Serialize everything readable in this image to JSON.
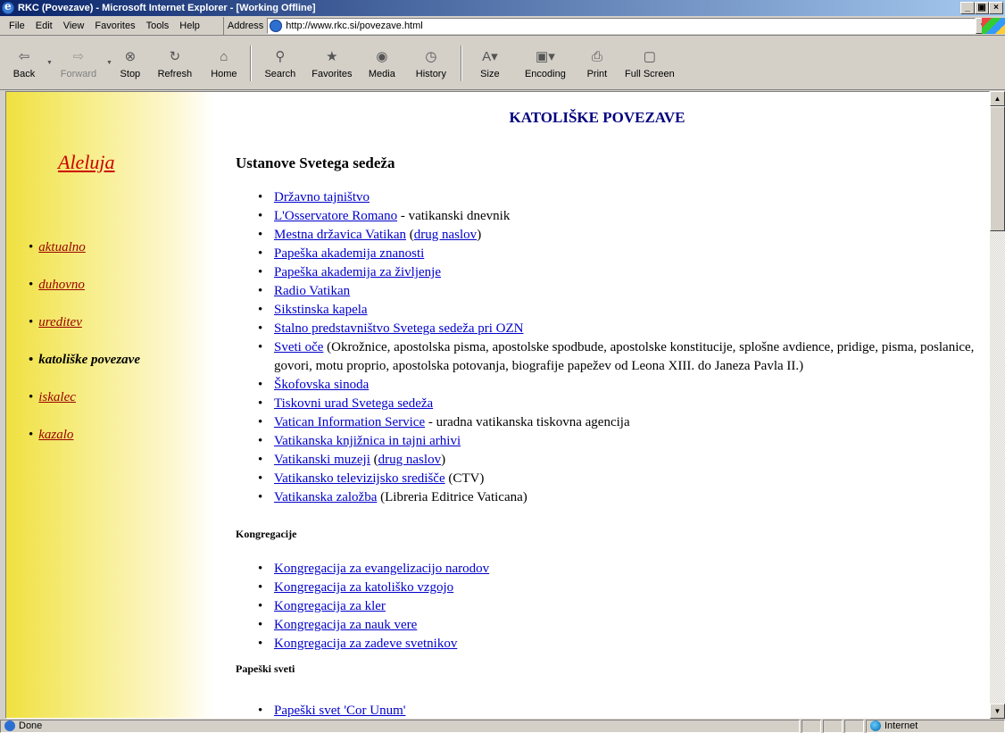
{
  "window": {
    "title": "RKC (Povezave) - Microsoft Internet Explorer - [Working Offline]",
    "buttons": [
      "_",
      "ѧ",
      "×"
    ]
  },
  "menu": [
    "File",
    "Edit",
    "View",
    "Favorites",
    "Tools",
    "Help"
  ],
  "address": {
    "label": "Address",
    "url": "http://www.rkc.si/povezave.html"
  },
  "toolbar": {
    "back": "Back",
    "forward": "Forward",
    "stop": "Stop",
    "refresh": "Refresh",
    "home": "Home",
    "search": "Search",
    "favorites": "Favorites",
    "media": "Media",
    "history": "History",
    "size": "Size",
    "encoding": "Encoding",
    "print": "Print",
    "fullscreen": "Full Screen"
  },
  "sidebar": {
    "logo": "Aleluja",
    "items": [
      {
        "label": "aktualno",
        "active": false
      },
      {
        "label": "duhovno",
        "active": false
      },
      {
        "label": "ureditev",
        "active": false
      },
      {
        "label": "katoliške povezave",
        "active": true
      },
      {
        "label": "iskalec",
        "active": false
      },
      {
        "label": "kazalo",
        "active": false
      }
    ]
  },
  "page": {
    "heading": "KATOLIŠKE POVEZAVE",
    "section1": {
      "title": "Ustanove Svetega sedeža",
      "items": [
        {
          "link": "Državno tajništvo"
        },
        {
          "link": "L'Osservatore Romano",
          "suffix": " - vatikanski dnevnik"
        },
        {
          "link": "Mestna državica Vatikan",
          "suffix": " (",
          "link2": "drug naslov",
          "suffix2": ")"
        },
        {
          "link": "Papeška akademija znanosti"
        },
        {
          "link": "Papeška akademija za življenje"
        },
        {
          "link": "Radio Vatikan"
        },
        {
          "link": "Sikstinska kapela"
        },
        {
          "link": "Stalno predstavništvo Svetega sedeža pri OZN"
        },
        {
          "link": "Sveti oče",
          "suffix": " (Okrožnice, apostolska pisma, apostolske spodbude, apostolske konstitucije, splošne avdience, pridige, pisma, poslanice, govori, motu proprio, apostolska potovanja, biografije papežev od Leona XIII. do Janeza Pavla II.)"
        },
        {
          "link": "Škofovska sinoda"
        },
        {
          "link": "Tiskovni urad Svetega sedeža"
        },
        {
          "link": "Vatican Information Service",
          "suffix": " - uradna vatikanska tiskovna agencija"
        },
        {
          "link": "Vatikanska knjižnica in tajni arhivi"
        },
        {
          "link": "Vatikanski muzeji",
          "suffix": " (",
          "link2": "drug naslov",
          "suffix2": ")"
        },
        {
          "link": "Vatikansko televizijsko središče",
          "suffix": " (CTV)"
        },
        {
          "link": "Vatikanska založba",
          "suffix": " (Libreria Editrice Vaticana)"
        }
      ]
    },
    "section2": {
      "title": "Kongregacije",
      "items": [
        {
          "link": "Kongregacija za evangelizacijo narodov"
        },
        {
          "link": "Kongregacija za katoliško vzgojo"
        },
        {
          "link": "Kongregacija za kler"
        },
        {
          "link": "Kongregacija za nauk vere"
        },
        {
          "link": "Kongregacija za zadeve svetnikov"
        }
      ]
    },
    "section3": {
      "title": "Papeški sveti",
      "items": [
        {
          "link": "Papeški svet 'Cor Unum'"
        }
      ]
    }
  },
  "status": {
    "text": "Done",
    "zone": "Internet"
  }
}
